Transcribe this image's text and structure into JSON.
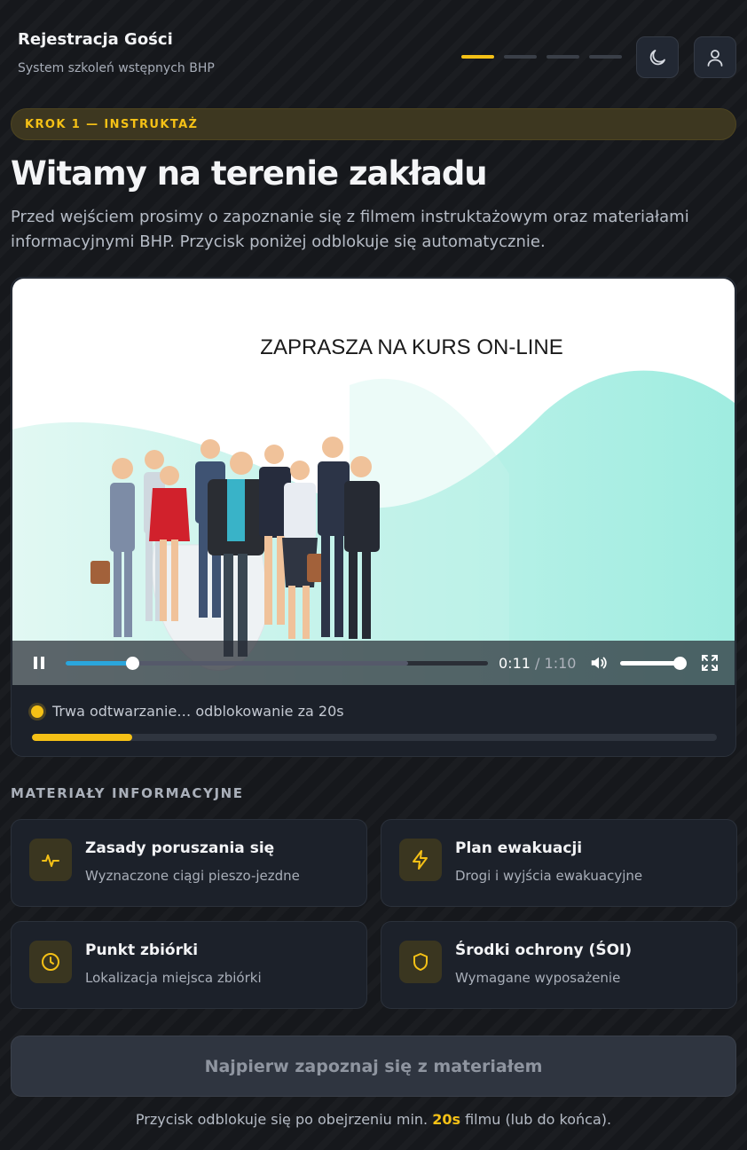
{
  "header": {
    "title": "Rejestracja Gości",
    "subtitle": "System szkoleń wstępnych BHP",
    "steps": {
      "total": 4,
      "active": 1
    },
    "theme_toggle_icon": "moon-icon",
    "profile_icon": "user-icon"
  },
  "step_pill": "KROK 1 — INSTRUKTAŻ",
  "page_title": "Witamy na terenie zakładu",
  "intro": "Przed wejściem prosimy o zapoznanie się z filmem instruktażowym oraz materiałami informacyjnymi BHP. Przycisk poniżej odblokuje się automatycznie.",
  "video": {
    "caption": "ZAPRASZA NA KURS ON-LINE",
    "current_time": "0:11",
    "time_separator": "/",
    "duration": "1:10",
    "played_fraction": 0.157,
    "buffered_fraction": 0.81,
    "volume_fraction": 1.0,
    "play_state": "playing"
  },
  "status": {
    "text": "Trwa odtwarzanie… odblokowanie za 20s",
    "unlock_progress": 0.147
  },
  "materials": {
    "title": "MATERIAŁY INFORMACYJNE",
    "items": [
      {
        "icon": "activity-icon",
        "title": "Zasady poruszania się",
        "desc": "Wyznaczone ciągi pieszo-jezdne"
      },
      {
        "icon": "lightning-icon",
        "title": "Plan ewakuacji",
        "desc": "Drogi i wyjścia ewakuacyjne"
      },
      {
        "icon": "clock-icon",
        "title": "Punkt zbiórki",
        "desc": "Lokalizacja miejsca zbiórki"
      },
      {
        "icon": "shield-icon",
        "title": "Środki ochrony (ŚOI)",
        "desc": "Wymagane wyposażenie"
      }
    ]
  },
  "cta": {
    "label": "Najpierw zapoznaj się z materiałem",
    "enabled": false
  },
  "footnote": {
    "before": "Przycisk odblokuje się po obejrzeniu min. ",
    "highlight": "20s",
    "after": " filmu (lub do końca)."
  },
  "colors": {
    "accent": "#f5c116",
    "background": "#16181c",
    "card": "#1c212a",
    "seek": "#2aa6dc",
    "teal": "#7fe6d6"
  }
}
